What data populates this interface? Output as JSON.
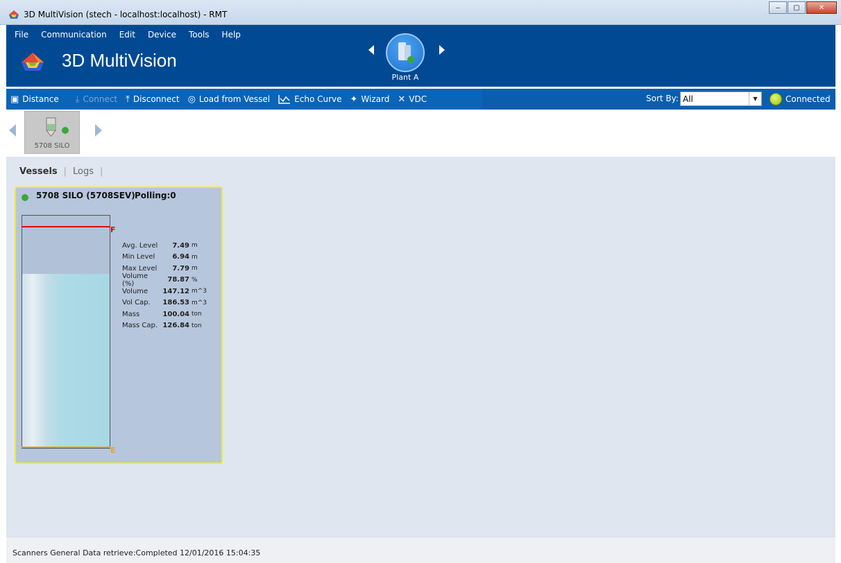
{
  "window": {
    "title": "3D MultiVision (stech - localhost:localhost) - RMT",
    "minimize": "‒",
    "maximize": "▢",
    "close": "✕"
  },
  "menu": [
    "File",
    "Communication",
    "Edit",
    "Device",
    "Tools",
    "Help"
  ],
  "brand": {
    "title": "3D MultiVision"
  },
  "plant": {
    "label": "Plant A"
  },
  "toolbar": {
    "items": [
      {
        "label": "Distance",
        "icon": "document-icon",
        "enabled": true
      },
      {
        "label": "Connect",
        "icon": "download-icon",
        "enabled": false
      },
      {
        "label": "Disconnect",
        "icon": "upload-icon",
        "enabled": true
      },
      {
        "label": "Load from Vessel",
        "icon": "broadcast-icon",
        "enabled": true
      },
      {
        "label": "Echo Curve",
        "icon": "chart-line-icon",
        "enabled": true
      },
      {
        "label": "Wizard",
        "icon": "magic-wand-icon",
        "enabled": true
      },
      {
        "label": "VDC",
        "icon": "tools-icon",
        "enabled": true
      }
    ],
    "sort_by_label": "Sort By:",
    "sort_value": "All",
    "connection_status": "Connected"
  },
  "vessel_strip": {
    "selected": {
      "label": "5708 SILO"
    }
  },
  "tabs": [
    {
      "label": "Vessels",
      "active": true
    },
    {
      "label": "Logs",
      "active": false
    }
  ],
  "vessel_card": {
    "name": "5708 SILO (5708SEV)",
    "polling": "Polling:0",
    "fill_fraction": 0.75,
    "full_marker": "F",
    "empty_marker": "E",
    "stats": [
      {
        "label": "Avg. Level",
        "value": "7.49",
        "unit": "m"
      },
      {
        "label": "Min Level",
        "value": "6.94",
        "unit": "m"
      },
      {
        "label": "Max Level",
        "value": "7.79",
        "unit": "m"
      },
      {
        "label": "Volume (%)",
        "value": "78.87",
        "unit": "%"
      },
      {
        "label": "Volume",
        "value": "147.12",
        "unit": "m^3"
      },
      {
        "label": "Vol Cap.",
        "value": "186.53",
        "unit": "m^3"
      },
      {
        "label": "Mass",
        "value": "100.04",
        "unit": "ton"
      },
      {
        "label": "Mass Cap.",
        "value": "126.84",
        "unit": "ton"
      }
    ]
  },
  "status_bar": {
    "text": "Scanners General Data retrieve:Completed 12/01/2016 15:04:35"
  },
  "colors": {
    "header": "#014a93",
    "toolbar": "#0a64b8",
    "connected": "#9dc315",
    "status_dot": "#39a935",
    "full_line": "#e00000",
    "empty_line": "#f0a020",
    "card_border": "#ecec3c"
  }
}
